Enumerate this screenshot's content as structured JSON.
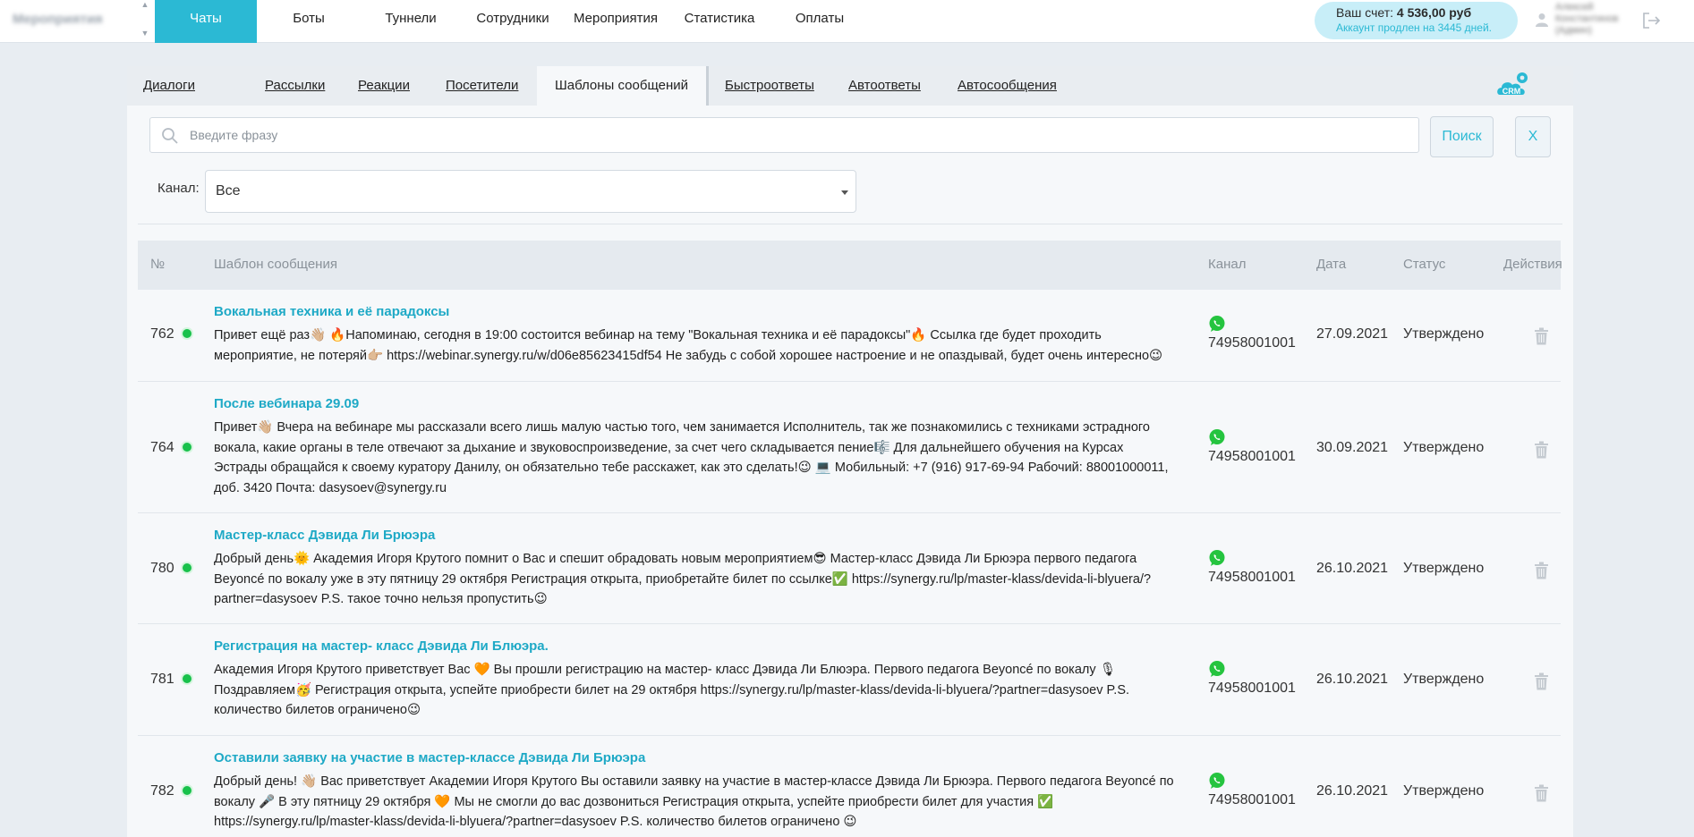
{
  "top_nav": {
    "project": "Мероприятия",
    "tabs": [
      "Чаты",
      "Боты",
      "Туннели",
      "Сотрудники",
      "Мероприятия",
      "Статистика",
      "Оплаты"
    ],
    "active_tab": "Чаты",
    "balance_label": "Ваш счет:",
    "balance_amount": "4 536,00 руб",
    "balance_note": "Аккаунт продлен на 3445 дней.",
    "user_name": "Алексей Константинов (Админ)"
  },
  "sub_tabs": {
    "items": [
      "Диалоги",
      "Рассылки",
      "Реакции",
      "Посетители",
      "Шаблоны сообщений",
      "Быстроответы",
      "Автоответы",
      "Автосообщения"
    ],
    "active": "Шаблоны сообщений",
    "crm_label": "CRM"
  },
  "search": {
    "placeholder": "Введите фразу",
    "value": "",
    "search_button": "Поиск",
    "clear_button": "X"
  },
  "filter": {
    "channel_label": "Канал:",
    "channel_value": "Все"
  },
  "table": {
    "headers": [
      "№",
      "Шаблон сообщения",
      "Канал",
      "Дата",
      "Статус",
      "Действия"
    ],
    "rows": [
      {
        "id": "762",
        "title": "Вокальная техника и её парадоксы",
        "text": "Привет ещё раз👋🏼 🔥Напоминаю, сегодня в 19:00 состоится вебинар на тему \"Вокальная техника и её парадоксы\"🔥 Ссылка где будет проходить мероприятие, не потеряй👉🏼 https://webinar.synergy.ru/w/d06e85623415df54 Не забудь с собой хорошее настроение и не опаздывай, будет очень интересно😉",
        "channel": "74958001001",
        "date": "27.09.2021",
        "status": "Утверждено"
      },
      {
        "id": "764",
        "title": "После вебинара 29.09",
        "text": "Привет👋🏼 Вчера на вебинаре мы рассказали всего лишь малую частью того, чем занимается Исполнитель, так же познакомились с техниками эстрадного вокала, какие органы в теле отвечают за дыхание и звуковоспроизведение, за счет чего складывается пение🎼 Для дальнейшего обучения на Курсах Эстрады обращайся к своему куратору Данилу, он обязательно тебе расскажет, как это сделать!😉 💻 Мобильный: +7 (916) 917-69-94 Рабочий: 88001000011, доб. 3420 Почта: dasysoev@synergy.ru",
        "channel": "74958001001",
        "date": "30.09.2021",
        "status": "Утверждено"
      },
      {
        "id": "780",
        "title": "Мастер-класс Дэвида Ли Брюэра",
        "text": "Добрый день🌞 Академия Игоря Крутого помнит о Вас и спешит обрадовать новым мероприятием😎 Мастер-класс Дэвида Ли Брюэра первого педагога Beyoncé по вокалу уже в эту пятницу 29 октября Регистрация открыта, приобретайте билет по ссылке✅ https://synergy.ru/lp/master-klass/devida-li-blyuera/?partner=dasysoev P.S. такое точно нельзя пропустить😉",
        "channel": "74958001001",
        "date": "26.10.2021",
        "status": "Утверждено"
      },
      {
        "id": "781",
        "title": "Регистрация на мастер- класс Дэвида Ли Блюэра.",
        "text": "Академия Игоря Крутого приветствует Вас 🧡 Вы прошли регистрацию на мастер- класс Дэвида Ли Блюэра. Первого педагога Beyoncé по вокалу 🎙 Поздравляем🥳 Регистрация открыта, успейте приобрести билет на 29 октября https://synergy.ru/lp/master-klass/devida-li-blyuera/?partner=dasysoev P.S. количество билетов ограничено😉",
        "channel": "74958001001",
        "date": "26.10.2021",
        "status": "Утверждено"
      },
      {
        "id": "782",
        "title": "Оставили заявку на участие в мастер-классе Дэвида Ли Брюэра",
        "text": "Добрый день! 👋🏼 Вас приветствует Академии Игоря Крутого Вы оставили заявку на участие в мастер-классе Дэвида Ли Брюэра. Первого педагога Beyoncé по вокалу 🎤 В эту пятницу 29 октября 🧡 Мы не смогли до вас дозвониться Регистрация открыта, успейте приобрести билет для участия ✅ https://synergy.ru/lp/master-klass/devida-li-blyuera/?partner=dasysoev P.S. количество билетов ограничено 😉",
        "channel": "74958001001",
        "date": "26.10.2021",
        "status": "Утверждено"
      }
    ]
  },
  "colors": {
    "accent": "#2bb9d4",
    "status_dot": "#18c14b",
    "whatsapp": "#25c43f"
  }
}
